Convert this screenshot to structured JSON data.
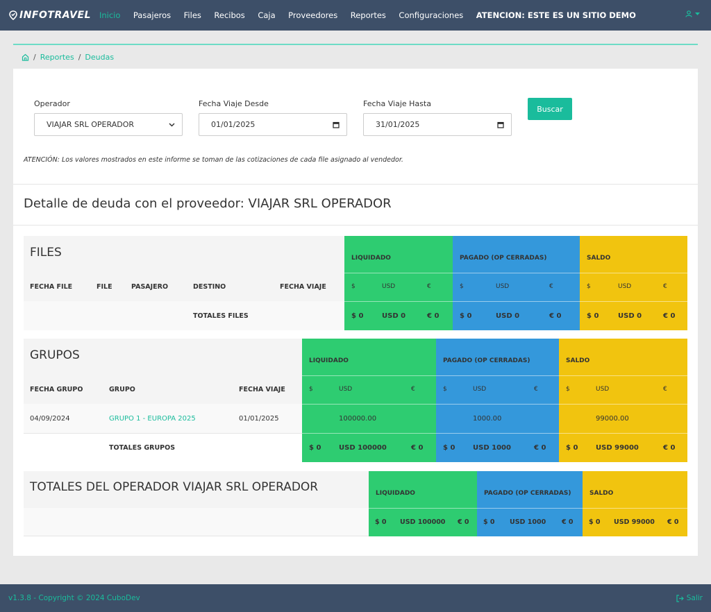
{
  "nav": {
    "brand": "INFOTRAVEL",
    "items": [
      "Inicio",
      "Pasajeros",
      "Files",
      "Recibos",
      "Caja",
      "Proveedores",
      "Reportes",
      "Configuraciones"
    ],
    "demo_notice": "ATENCION: ESTE ES UN SITIO DEMO"
  },
  "breadcrumb": {
    "items": [
      "Reportes",
      "Deudas"
    ],
    "separator": "/"
  },
  "form": {
    "operador_label": "Operador",
    "operador_value": "VIAJAR SRL OPERADOR",
    "desde_label": "Fecha Viaje Desde",
    "desde_value": "01/01/2025",
    "hasta_label": "Fecha Viaje Hasta",
    "hasta_value": "31/01/2025",
    "buscar": "Buscar"
  },
  "note": "ATENCIÓN: Los valores mostrados en este informe se toman de las cotizaciones de cada file asignado al vendedor.",
  "detail_title": "Detalle de deuda con el proveedor: VIAJAR SRL OPERADOR",
  "sections": {
    "liquidado": "LIQUIDADO",
    "pagado": "PAGADO (OP CERRADAS)",
    "saldo": "SALDO",
    "cur": [
      "$",
      "USD",
      "€"
    ]
  },
  "files": {
    "title": "FILES",
    "columns": [
      "FECHA FILE",
      "FILE",
      "PASAJERO",
      "DESTINO",
      "FECHA VIAJE"
    ],
    "totals_label": "TOTALES FILES",
    "liquidado_tot": [
      "$ 0",
      "USD 0",
      "€ 0"
    ],
    "pagado_tot": [
      "$ 0",
      "USD 0",
      "€ 0"
    ],
    "saldo_tot": [
      "$ 0",
      "USD 0",
      "€ 0"
    ]
  },
  "grupos": {
    "title": "GRUPOS",
    "columns": [
      "FECHA GRUPO",
      "GRUPO",
      "FECHA VIAJE"
    ],
    "rows": [
      {
        "fecha_grupo": "04/09/2024",
        "grupo": "GRUPO 1 - EUROPA 2025",
        "fecha_viaje": "01/01/2025",
        "liquidado": "100000.00",
        "pagado": "1000.00",
        "saldo": "99000.00"
      }
    ],
    "totals_label": "TOTALES GRUPOS",
    "liquidado_tot": [
      "$ 0",
      "USD 100000",
      "€ 0"
    ],
    "pagado_tot": [
      "$ 0",
      "USD 1000",
      "€ 0"
    ],
    "saldo_tot": [
      "$ 0",
      "USD 99000",
      "€ 0"
    ]
  },
  "totales": {
    "title": "TOTALES DEL OPERADOR VIAJAR SRL OPERADOR",
    "liquidado_tot": [
      "$ 0",
      "USD 100000",
      "€ 0"
    ],
    "pagado_tot": [
      "$ 0",
      "USD 1000",
      "€ 0"
    ],
    "saldo_tot": [
      "$ 0",
      "USD 99000",
      "€ 0"
    ]
  },
  "footer": {
    "copyright": "v1.3.8 - Copyright © 2024 CuboDev",
    "logout": "Salir"
  },
  "colors": {
    "navbar": "#3d4f68",
    "accent": "#1abc9c",
    "green": "#2ecc71",
    "blue": "#3498db",
    "yellow": "#f1c40f"
  }
}
